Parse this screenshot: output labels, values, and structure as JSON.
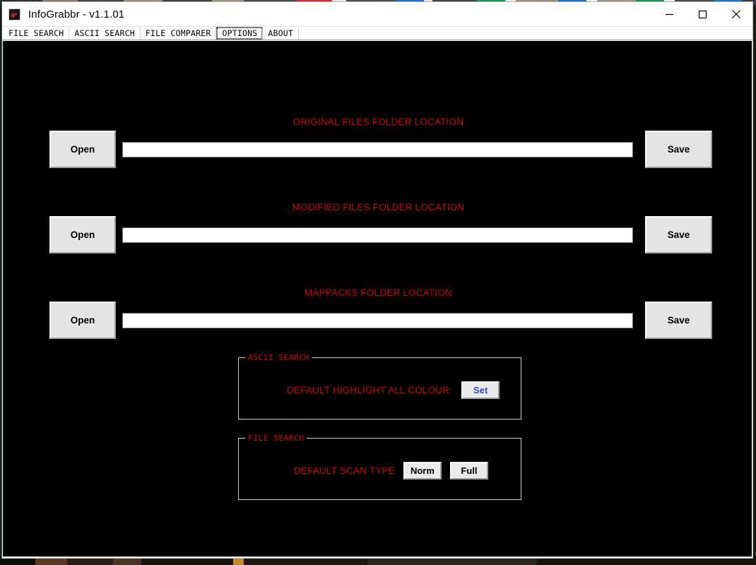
{
  "window": {
    "title": "InfoGrabbr - v1.1.01",
    "icon": "app-icon",
    "controls": {
      "minimize": "minimize-icon",
      "maximize": "maximize-icon",
      "close": "close-icon"
    }
  },
  "menu": {
    "tabs": [
      {
        "label": "FILE SEARCH",
        "selected": false
      },
      {
        "label": "ASCII SEARCH",
        "selected": false
      },
      {
        "label": "FILE COMPARER",
        "selected": false
      },
      {
        "label": "OPTIONS",
        "selected": true
      },
      {
        "label": "ABOUT",
        "selected": false
      }
    ]
  },
  "colors": {
    "label_red": "#cc0000",
    "client_background": "#000000",
    "button_face": "#e4e4e4",
    "set_button_text": "#2b4ad0"
  },
  "folder_rows": [
    {
      "label": "ORIGINAL FILES FOLDER LOCATION",
      "open_label": "Open",
      "save_label": "Save",
      "path_value": "",
      "path_placeholder": ""
    },
    {
      "label": "MODIFIED FILES FOLDER LOCATION",
      "open_label": "Open",
      "save_label": "Save",
      "path_value": "",
      "path_placeholder": ""
    },
    {
      "label": "MAPPACKS FOLDER LOCATION",
      "open_label": "Open",
      "save_label": "Save",
      "path_value": "",
      "path_placeholder": ""
    }
  ],
  "ascii_search_group": {
    "title": "ASCII SEARCH",
    "row_label": "DEFAULT HIGHLIGHT ALL COLOUR",
    "set_label": "Set"
  },
  "file_search_group": {
    "title": "FILE SEARCH",
    "row_label": "DEFAULT SCAN TYPE",
    "norm_label": "Norm",
    "full_label": "Full"
  }
}
